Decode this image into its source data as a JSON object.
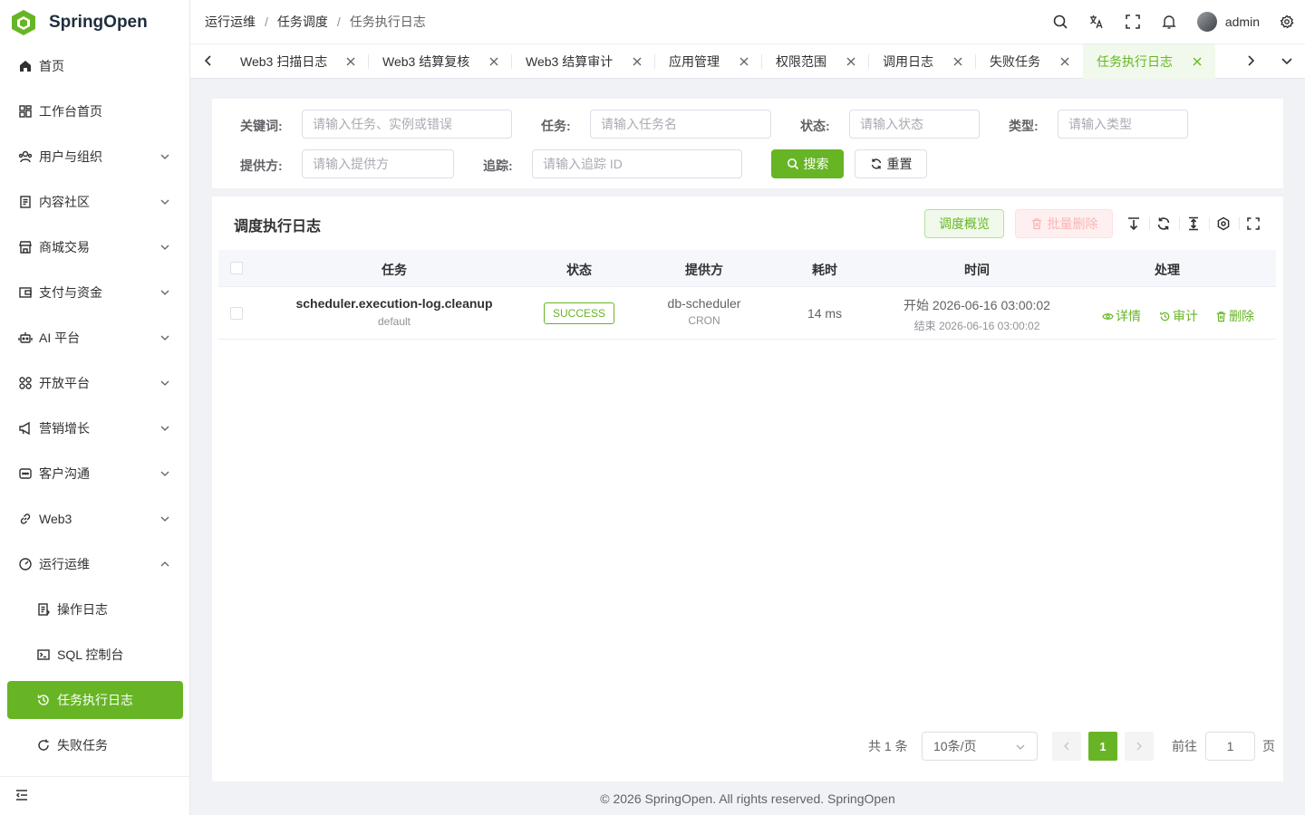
{
  "app": {
    "name": "SpringOpen"
  },
  "sidebar": {
    "items": [
      {
        "label": "首页"
      },
      {
        "label": "工作台首页"
      },
      {
        "label": "用户与组织"
      },
      {
        "label": "内容社区"
      },
      {
        "label": "商城交易"
      },
      {
        "label": "支付与资金"
      },
      {
        "label": "AI 平台"
      },
      {
        "label": "开放平台"
      },
      {
        "label": "营销增长"
      },
      {
        "label": "客户沟通"
      },
      {
        "label": "Web3"
      },
      {
        "label": "运行运维"
      }
    ],
    "sub_items": [
      {
        "label": "操作日志"
      },
      {
        "label": "SQL 控制台"
      },
      {
        "label": "任务执行日志"
      },
      {
        "label": "失败任务"
      }
    ]
  },
  "header": {
    "breadcrumb": [
      "运行运维",
      "任务调度",
      "任务执行日志"
    ],
    "username": "admin"
  },
  "tabs": [
    {
      "label": "Web3 扫描日志"
    },
    {
      "label": "Web3 结算复核"
    },
    {
      "label": "Web3 结算审计"
    },
    {
      "label": "应用管理"
    },
    {
      "label": "权限范围"
    },
    {
      "label": "调用日志"
    },
    {
      "label": "失败任务"
    },
    {
      "label": "任务执行日志"
    }
  ],
  "filters": {
    "keyword": {
      "label": "关键词:",
      "placeholder": "请输入任务、实例或错误"
    },
    "task": {
      "label": "任务:",
      "placeholder": "请输入任务名"
    },
    "status": {
      "label": "状态:",
      "placeholder": "请输入状态"
    },
    "type": {
      "label": "类型:",
      "placeholder": "请输入类型"
    },
    "provider": {
      "label": "提供方:",
      "placeholder": "请输入提供方"
    },
    "trace": {
      "label": "追踪:",
      "placeholder": "请输入追踪 ID"
    },
    "search_label": "搜索",
    "reset_label": "重置"
  },
  "table": {
    "title": "调度执行日志",
    "overview_label": "调度概览",
    "batch_delete_label": "批量删除",
    "columns": [
      "任务",
      "状态",
      "提供方",
      "耗时",
      "时间",
      "处理"
    ],
    "rows": [
      {
        "task": "scheduler.execution-log.cleanup",
        "instance": "default",
        "status": "SUCCESS",
        "provider": "db-scheduler",
        "provider_type": "CRON",
        "duration": "14 ms",
        "start": "开始 2026-06-16 03:00:02",
        "end": "结束 2026-06-16 03:00:02",
        "actions": [
          "详情",
          "审计",
          "删除"
        ]
      }
    ]
  },
  "pagination": {
    "total": "共 1 条",
    "page_size": "10条/页",
    "current": "1",
    "goto_prefix": "前往",
    "goto_value": "1",
    "goto_suffix": "页"
  },
  "footer": {
    "text": "© 2026 SpringOpen. All rights reserved. SpringOpen"
  },
  "colors": {
    "accent": "#67b525",
    "danger_light": "#fab6b6",
    "background": "#f0f2f5"
  }
}
